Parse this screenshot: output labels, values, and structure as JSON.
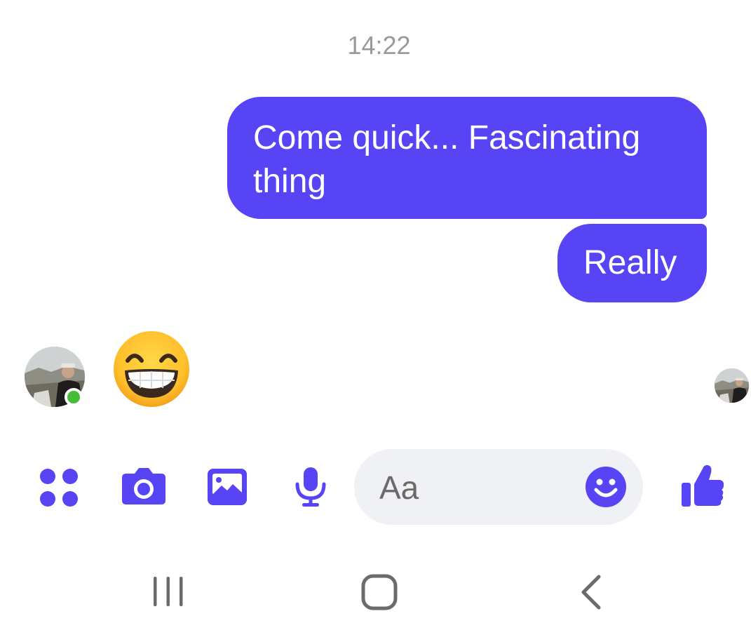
{
  "conversation": {
    "timestamp": "14:22",
    "messages": [
      {
        "from": "me",
        "text_line1": "Come quick... Fascinating",
        "text_line2": "thing"
      },
      {
        "from": "me",
        "text": "Really"
      },
      {
        "from": "contact",
        "emoji_name": "beaming-face-with-smiling-eyes",
        "emoji_char": "😁"
      }
    ],
    "contact_status": "online"
  },
  "composer": {
    "placeholder": "Aa",
    "icons": [
      "apps-icon",
      "camera-icon",
      "gallery-icon",
      "microphone-icon",
      "emoji-icon",
      "thumbs-up-icon"
    ]
  },
  "navbar": {
    "icons": [
      "recent-apps-icon",
      "home-icon",
      "back-icon"
    ]
  },
  "colors": {
    "accent": "#5644f5",
    "online": "#45bd37",
    "timestamp": "#9a9a9a",
    "input_bg": "#f0f1f4",
    "nav_icon": "#6b6b6b"
  }
}
